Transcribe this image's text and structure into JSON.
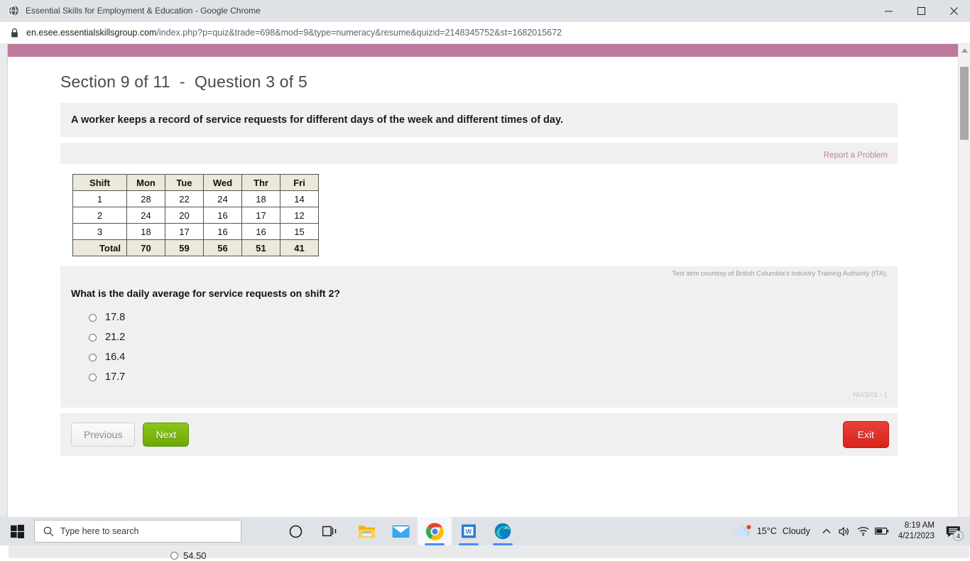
{
  "browser": {
    "window_title": "Essential Skills for Employment & Education - Google Chrome",
    "favicon_name": "globe-favicon",
    "url_host": "en.esee.essentialskillsgroup.com",
    "url_path": "/index.php?p=quiz&trade=698&mod=9&type=numeracy&resume&quizid=2148345752&st=1682015672",
    "minimize_label": "Minimize",
    "maximize_label": "Maximize",
    "close_label": "Close"
  },
  "quiz": {
    "section_heading": "Section 9 of 11  -  Question 3 of 5",
    "prompt": "A worker keeps a record of service requests for different days of the week and different times of day.",
    "report_link": "Report a Problem",
    "courtesy": "Test item courtesy of British Columbia's Industry Training Authority (ITA).",
    "question": "What is the daily average for service requests on shift 2?",
    "options": [
      "17.8",
      "21.2",
      "16.4",
      "17.7"
    ],
    "item_code": "NU/3/01 - 1",
    "accent_pink": "#bd7a9d",
    "next_color": "#76b900",
    "exit_color": "#dc2a21"
  },
  "table": {
    "headers": [
      "Shift",
      "Mon",
      "Tue",
      "Wed",
      "Thr",
      "Fri"
    ],
    "rows": [
      [
        "1",
        "28",
        "22",
        "24",
        "18",
        "14"
      ],
      [
        "2",
        "24",
        "20",
        "16",
        "17",
        "12"
      ],
      [
        "3",
        "18",
        "17",
        "16",
        "16",
        "15"
      ]
    ],
    "total_row": [
      "Total",
      "70",
      "59",
      "56",
      "51",
      "41"
    ]
  },
  "nav": {
    "previous": "Previous",
    "next": "Next",
    "exit": "Exit"
  },
  "background_window": {
    "visible_option": "54.50"
  },
  "taskbar": {
    "start_label": "Start",
    "search_placeholder": "Type here to search",
    "items": [
      {
        "name": "cortana-icon",
        "label": "Cortana"
      },
      {
        "name": "task-view-icon",
        "label": "Task View"
      },
      {
        "name": "file-explorer-icon",
        "label": "File Explorer"
      },
      {
        "name": "mail-icon",
        "label": "Mail"
      },
      {
        "name": "chrome-icon",
        "label": "Google Chrome"
      },
      {
        "name": "word-icon",
        "label": "Microsoft Word"
      },
      {
        "name": "edge-icon",
        "label": "Microsoft Edge"
      }
    ],
    "weather_temp": "15°C",
    "weather_desc": "Cloudy",
    "time": "8:19 AM",
    "date": "4/21/2023",
    "notification_count": "4"
  }
}
